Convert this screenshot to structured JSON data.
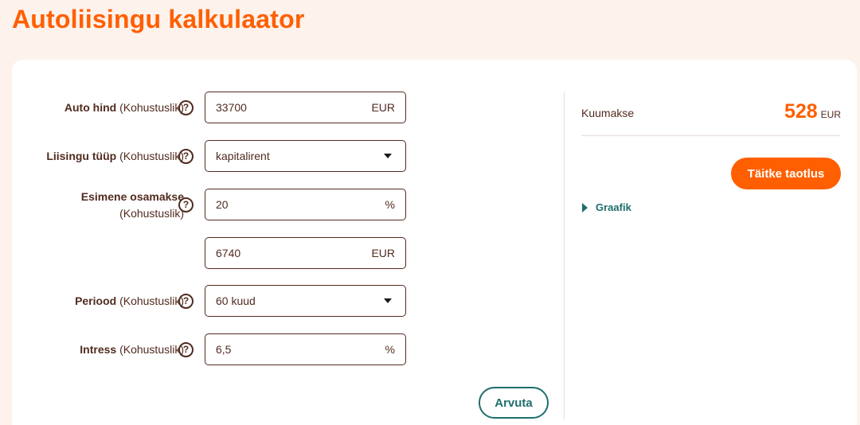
{
  "page": {
    "title": "Autoliisingu kalkulaator"
  },
  "form": {
    "optional_tag": "(Kohustuslik)",
    "help_glyph": "?",
    "car_price": {
      "label": "Auto hind",
      "value": "33700",
      "unit": "EUR"
    },
    "lease_type": {
      "label": "Liisingu tüüp",
      "value": "kapitalirent"
    },
    "down_payment": {
      "label": "Esimene osamakse",
      "percent_value": "20",
      "percent_unit": "%",
      "amount_value": "6740",
      "amount_unit": "EUR"
    },
    "period": {
      "label": "Periood",
      "value": "60 kuud"
    },
    "interest": {
      "label": "Intress",
      "value": "6,5",
      "unit": "%"
    },
    "calculate_label": "Arvuta"
  },
  "result": {
    "monthly_label": "Kuumakse",
    "monthly_amount": "528",
    "monthly_unit": "EUR",
    "apply_label": "Täitke taotlus",
    "schedule_label": "Graafik"
  },
  "colors": {
    "brand": "#ff5f00",
    "accent": "#1f6e6e",
    "text": "#512b1f",
    "background": "#fdf2ec"
  }
}
